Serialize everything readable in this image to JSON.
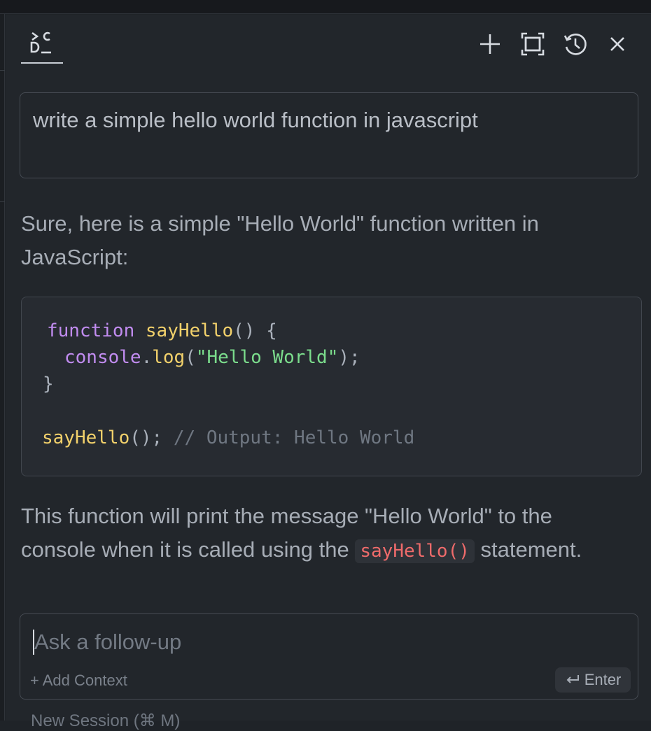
{
  "header": {
    "logo_text": ">C D_",
    "icons": [
      "plus-icon",
      "fullscreen-icon",
      "history-icon",
      "close-icon"
    ]
  },
  "prompt": {
    "text": "write a simple hello world function in javascript"
  },
  "response": {
    "intro_line1": "Sure, here is a simple \"Hello World\" function written in",
    "intro_line2": "JavaScript:",
    "code": {
      "l1_keyword": "function",
      "l1_name": "sayHello",
      "l1_rest": "() {",
      "l2_object": "console",
      "l2_dot": ".",
      "l2_method": "log",
      "l2_open": "(",
      "l2_string": "\"Hello World\"",
      "l2_close": ");",
      "l3": "}",
      "l5_call": "sayHello",
      "l5_rest": "();",
      "l5_comment": "// Output: Hello World"
    },
    "outro_line1": "This function will print the message \"Hello World\" to the",
    "outro_before": "console when it is called using the",
    "outro_code": "sayHello()",
    "outro_after": "statement."
  },
  "followup": {
    "placeholder": "Ask a follow-up",
    "add_context": "+ Add Context",
    "enter_label": "Enter"
  },
  "footer": {
    "new_session": "New Session (⌘ M)"
  },
  "colors": {
    "background": "#22262b",
    "keyword": "#c18cf0",
    "function_name": "#f2d16b",
    "string": "#7bdc8c",
    "comment": "#6f7782",
    "inline_code": "#ef6b6b"
  }
}
